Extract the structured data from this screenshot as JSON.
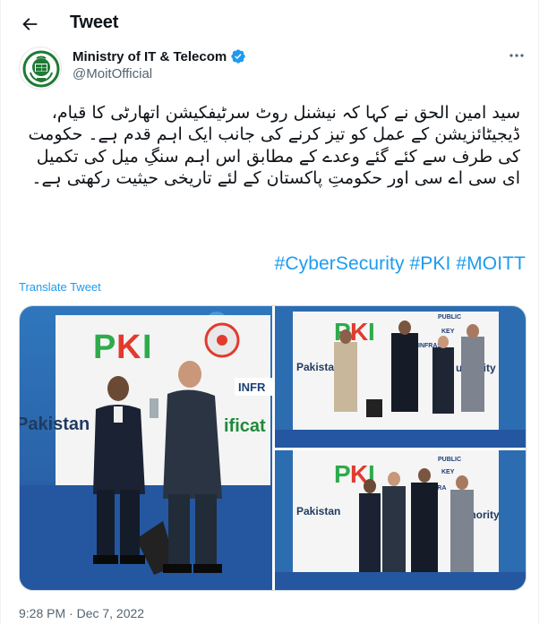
{
  "header": {
    "title": "Tweet"
  },
  "author": {
    "display_name": "Ministry of IT & Telecom",
    "handle": "@MoitOfficial",
    "verified": true
  },
  "tweet": {
    "text": "سید امین الحق نے کہا کہ نیشنل روٹ سرٹیفکیشن اتھارٹی کا قیام، ڈیجیٹائزیشن کے عمل کو تیز کرنے کی جانب ایک اہم قدم ہے۔ حکومت کی طرف سے کئے گئے وعدے کے مطابق اس اہم سنگِ میل کی تکمیل ای سی اے سی اور حکومتِ پاکستان کے لئے تاریخی حیثیت رکھتی ہے۔",
    "hashtags": [
      "#CyberSecurity",
      "#PKI",
      "#MOITT"
    ],
    "translate_label": "Translate Tweet",
    "timestamp": "9:28 PM · Dec 7, 2022"
  },
  "media": {
    "photos": [
      {
        "banner_text": "Pakistan",
        "banner_text_2": "ificat",
        "logo": "PKI",
        "tag": "INFR"
      },
      {
        "banner_text": "Pakistan",
        "banner_text_2": "uthority",
        "logo": "PKI",
        "tags": [
          "PUBLIC",
          "KEY",
          "INFRAS"
        ]
      },
      {
        "banner_text": "Pakistan",
        "banner_text_2": "uthority",
        "logo": "PKI",
        "tags": [
          "PUBLIC",
          "KEY",
          "INFRA"
        ]
      }
    ]
  },
  "colors": {
    "accent": "#1d9bf0",
    "secondary_text": "#536471",
    "stage_blue": "#2a6fb5",
    "pki_red": "#e23b2e",
    "pki_green": "#2eab4a",
    "banner_green": "#1f8a3a"
  },
  "icons": {
    "back": "arrow-left-icon",
    "verified": "verified-badge-icon",
    "more": "more-dots-icon",
    "avatar": "moit-emblem-icon"
  }
}
